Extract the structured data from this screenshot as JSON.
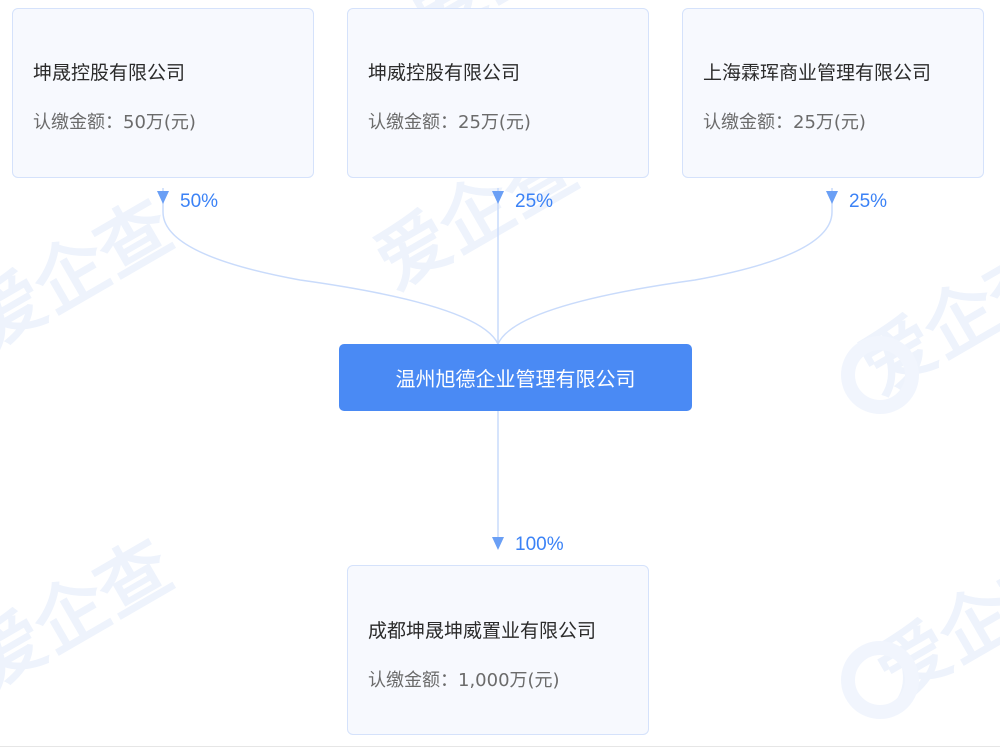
{
  "shareholders": [
    {
      "name": "坤晟控股有限公司",
      "amount": "认缴金额：50万(元)",
      "percent": "50%"
    },
    {
      "name": "坤威控股有限公司",
      "amount": "认缴金额：25万(元)",
      "percent": "25%"
    },
    {
      "name": "上海霖珲商业管理有限公司",
      "amount": "认缴金额：25万(元)",
      "percent": "25%"
    }
  ],
  "center_company": {
    "name": "温州旭德企业管理有限公司"
  },
  "investment": {
    "percent": "100%",
    "name": "成都坤晟坤威置业有限公司",
    "amount": "认缴金额：1,000万(元)"
  },
  "watermark": {
    "brand_text": "爱企查"
  },
  "colors": {
    "accent": "#4a8af4",
    "link_line": "#c9dbfb",
    "arrow": "#6a9ff5",
    "card_bg": "#f7f9fe",
    "card_border": "#d5e2fb",
    "watermark": "#eef3fc"
  }
}
